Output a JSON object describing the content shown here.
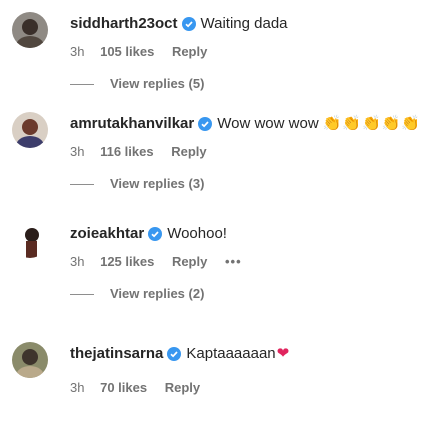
{
  "comments": [
    {
      "username": "siddharth23oct",
      "text": "Waiting dada",
      "time": "3h",
      "likes": "105 likes",
      "reply": "Reply",
      "view_replies": "View replies (5)"
    },
    {
      "username": "amrutakhanvilkar",
      "text": "Wow wow wow",
      "emoji": [
        "👏",
        "👏",
        "👏",
        "👏",
        "👏"
      ],
      "time": "3h",
      "likes": "116 likes",
      "reply": "Reply",
      "view_replies": "View replies (3)"
    },
    {
      "username": "zoieakhtar",
      "text": "Woohoo!",
      "time": "3h",
      "likes": "125 likes",
      "reply": "Reply",
      "more": "•••",
      "view_replies": "View replies (2)"
    },
    {
      "username": "thejatinsarna",
      "text": "Kaptaaaaaan",
      "emoji_heart": "❤",
      "time": "3h",
      "likes": "70 likes",
      "reply": "Reply"
    }
  ],
  "colors": {
    "verified": "#3897f0",
    "heart": "#e0245e",
    "meta": "#737373"
  }
}
